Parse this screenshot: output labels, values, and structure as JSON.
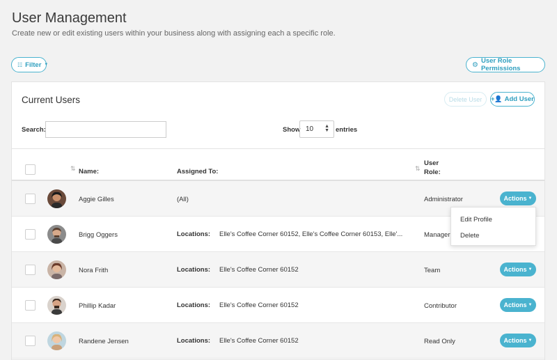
{
  "header": {
    "title": "User Management",
    "subtitle": "Create new or edit existing users within your business along with assigning each a specific role."
  },
  "toolbar": {
    "filter_label": "Filter",
    "permissions_label": "User Role Permissions"
  },
  "card": {
    "title": "Current Users",
    "delete_label": "Delete User",
    "add_label": "Add User",
    "search_label": "Search:",
    "search_value": "",
    "show_label": "Show",
    "show_value": "10",
    "entries_label": "entries"
  },
  "table": {
    "headers": {
      "name": "Name:",
      "assigned": "Assigned To:",
      "role_line1": "User",
      "role_line2": "Role:"
    },
    "rows": [
      {
        "name": "Aggie Gilles",
        "assigned_label": "",
        "assigned_value": "(All)",
        "role": "Administrator",
        "actions": "Actions"
      },
      {
        "name": "Brigg Oggers",
        "assigned_label": "Locations:",
        "assigned_value": "Elle's Coffee Corner 60152, Elle's Coffee Corner 60153, Elle'...",
        "role": "Manager",
        "actions": "Actions"
      },
      {
        "name": "Nora Frith",
        "assigned_label": "Locations:",
        "assigned_value": "Elle's Coffee Corner 60152",
        "role": "Team",
        "actions": "Actions"
      },
      {
        "name": "Phillip Kadar",
        "assigned_label": "Locations:",
        "assigned_value": "Elle's Coffee Corner 60152",
        "role": "Contributor",
        "actions": "Actions"
      },
      {
        "name": "Randene Jensen",
        "assigned_label": "Locations:",
        "assigned_value": "Elle's Coffee Corner 60152",
        "role": "Read Only",
        "actions": "Actions"
      }
    ]
  },
  "dropdown": {
    "items": [
      "Edit Profile",
      "Delete"
    ]
  },
  "colors": {
    "accent": "#4ab3cf",
    "accent_text": "#2f9fbf",
    "background": "#f2f2f2"
  }
}
